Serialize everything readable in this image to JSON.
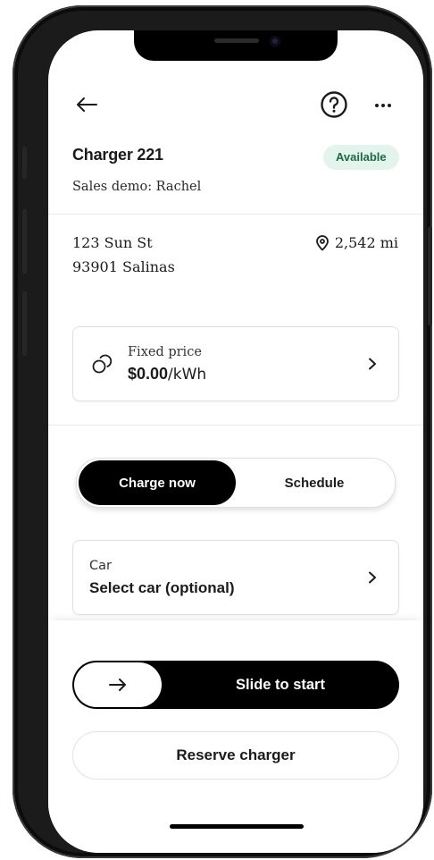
{
  "header": {
    "back_icon": "arrow-left-icon",
    "help_icon": "question-circle-icon",
    "more_icon": "more-dots-icon"
  },
  "charger": {
    "title": "Charger 221",
    "status": "Available",
    "subtitle": "Sales demo: Rachel",
    "status_color": "#1d6b46",
    "status_bg": "#e3f4ec"
  },
  "location": {
    "street": "123 Sun St",
    "city": "93901 Salinas",
    "distance": "2,542 mi",
    "distance_icon": "map-pin-icon"
  },
  "pricing": {
    "label": "Fixed price",
    "amount": "$0.00",
    "unit": "/kWh",
    "icon": "coins-icon"
  },
  "mode_toggle": {
    "options": [
      {
        "label": "Charge now",
        "active": true
      },
      {
        "label": "Schedule",
        "active": false
      }
    ]
  },
  "car": {
    "label": "Car",
    "value": "Select car (optional)"
  },
  "actions": {
    "slide_label": "Slide to start",
    "reserve_label": "Reserve charger",
    "slide_icon": "arrow-right-icon"
  },
  "colors": {
    "primary": "#000000",
    "text": "#1b1b1b",
    "border": "#dfe1e6"
  }
}
